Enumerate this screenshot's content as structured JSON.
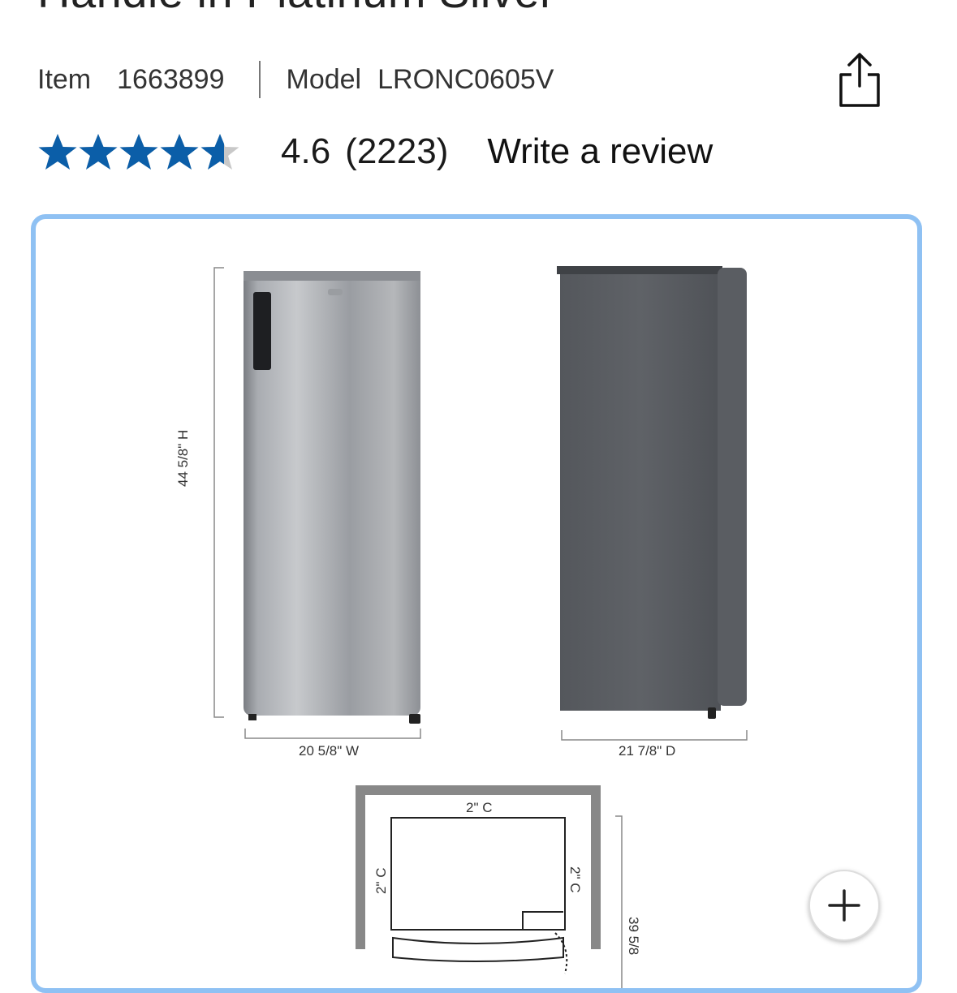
{
  "product": {
    "title_fragment": "Handle in Platinum Silver",
    "item_label": "Item",
    "item_number": "1663899",
    "model_label": "Model",
    "model_number": "LRONC0605V"
  },
  "rating": {
    "value": "4.6",
    "count": "(2223)",
    "stars_filled": 4.6,
    "stars_total": 5,
    "star_color": "#0b5ea8",
    "write_review": "Write a review"
  },
  "icons": {
    "share": "share-icon",
    "zoom": "plus-icon"
  },
  "gallery": {
    "border_color": "#8fc1f3",
    "labels": {
      "height": "44 5/8\" H",
      "width": "20 5/8\" W",
      "depth": "21 7/8\" D",
      "clearance_top": "2\" C",
      "clearance_left": "2\" C",
      "clearance_right": "2\" C",
      "bottom_dim": "39 5/8"
    }
  }
}
